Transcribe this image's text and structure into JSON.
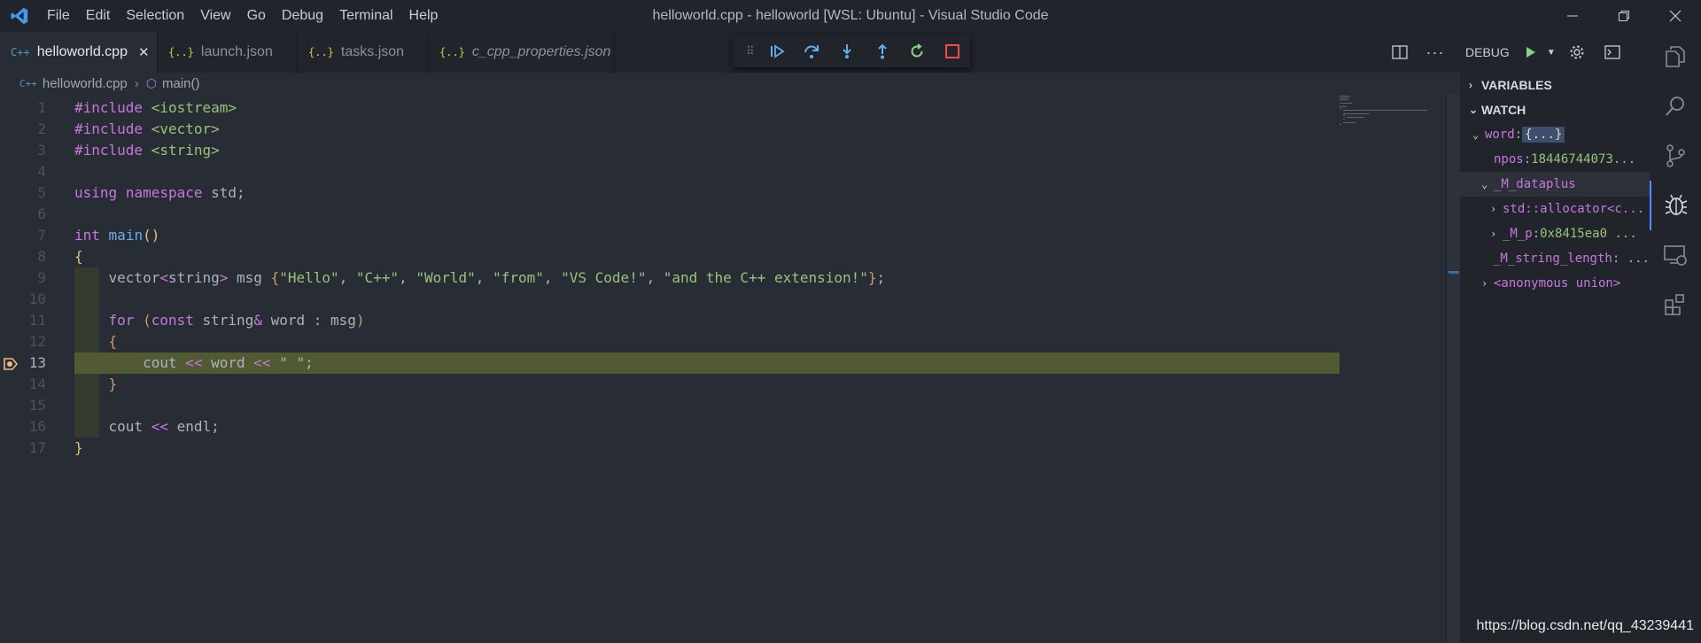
{
  "window": {
    "title": "helloworld.cpp - helloworld [WSL: Ubuntu] - Visual Studio Code",
    "menu": [
      "File",
      "Edit",
      "Selection",
      "View",
      "Go",
      "Debug",
      "Terminal",
      "Help"
    ]
  },
  "tabs": [
    {
      "label": "helloworld.cpp",
      "icon": "C++",
      "active": true,
      "italic": false
    },
    {
      "label": "launch.json",
      "icon": "{..}",
      "active": false,
      "italic": false
    },
    {
      "label": "tasks.json",
      "icon": "{..}",
      "active": false,
      "italic": false
    },
    {
      "label": "c_cpp_properties.json",
      "icon": "{..}",
      "active": false,
      "italic": true
    }
  ],
  "debug_toolbar": {
    "buttons": [
      "continue",
      "step-over",
      "step-into",
      "step-out",
      "restart",
      "stop"
    ]
  },
  "editor_actions": {
    "debug_label": "DEBUG"
  },
  "breadcrumb": {
    "file_icon": "C++",
    "file": "helloworld.cpp",
    "symbol": "main()"
  },
  "editor": {
    "current_line": 13,
    "lines": [
      {
        "n": "1",
        "tokens": [
          [
            "k",
            "#include"
          ],
          [
            "",
            " "
          ],
          [
            "s",
            "<iostream>"
          ]
        ]
      },
      {
        "n": "2",
        "tokens": [
          [
            "k",
            "#include"
          ],
          [
            "",
            " "
          ],
          [
            "s",
            "<vector>"
          ]
        ]
      },
      {
        "n": "3",
        "tokens": [
          [
            "k",
            "#include"
          ],
          [
            "",
            " "
          ],
          [
            "s",
            "<string>"
          ]
        ]
      },
      {
        "n": "4",
        "tokens": []
      },
      {
        "n": "5",
        "tokens": [
          [
            "k",
            "using"
          ],
          [
            "",
            " "
          ],
          [
            "k",
            "namespace"
          ],
          [
            "",
            " std;"
          ]
        ]
      },
      {
        "n": "6",
        "tokens": []
      },
      {
        "n": "7",
        "tokens": [
          [
            "k",
            "int"
          ],
          [
            "",
            " "
          ],
          [
            "f",
            "main"
          ],
          [
            "t",
            "()"
          ]
        ]
      },
      {
        "n": "8",
        "tokens": [
          [
            "t",
            "{"
          ]
        ]
      },
      {
        "n": "9",
        "tokens": [
          [
            "",
            "    vector"
          ],
          [
            "op",
            "<"
          ],
          [
            "",
            "string"
          ],
          [
            "op",
            ">"
          ],
          [
            "",
            " msg "
          ],
          [
            "p",
            "{"
          ],
          [
            "s",
            "\"Hello\""
          ],
          [
            "",
            ", "
          ],
          [
            "s",
            "\"C++\""
          ],
          [
            "",
            ", "
          ],
          [
            "s",
            "\"World\""
          ],
          [
            "",
            ", "
          ],
          [
            "s",
            "\"from\""
          ],
          [
            "",
            ", "
          ],
          [
            "s",
            "\"VS Code!\""
          ],
          [
            "",
            ", "
          ],
          [
            "s",
            "\"and the C++ extension!\""
          ],
          [
            "p",
            "}"
          ],
          [
            "",
            ";"
          ]
        ]
      },
      {
        "n": "10",
        "tokens": []
      },
      {
        "n": "11",
        "tokens": [
          [
            "",
            "    "
          ],
          [
            "k",
            "for"
          ],
          [
            "",
            " "
          ],
          [
            "p",
            "("
          ],
          [
            "k",
            "const"
          ],
          [
            "",
            " string"
          ],
          [
            "op",
            "&"
          ],
          [
            "",
            " word : msg"
          ],
          [
            "p",
            ")"
          ]
        ]
      },
      {
        "n": "12",
        "tokens": [
          [
            "",
            "    "
          ],
          [
            "p",
            "{"
          ]
        ]
      },
      {
        "n": "13",
        "tokens": [
          [
            "",
            "        cout "
          ],
          [
            "op",
            "<<"
          ],
          [
            "",
            " word "
          ],
          [
            "op",
            "<<"
          ],
          [
            "",
            " "
          ],
          [
            "s",
            "\" \""
          ],
          [
            "",
            ";"
          ]
        ]
      },
      {
        "n": "14",
        "tokens": [
          [
            "",
            "    "
          ],
          [
            "p",
            "}"
          ]
        ]
      },
      {
        "n": "15",
        "tokens": []
      },
      {
        "n": "16",
        "tokens": [
          [
            "",
            "    cout "
          ],
          [
            "op",
            "<<"
          ],
          [
            "",
            " endl;"
          ]
        ]
      },
      {
        "n": "17",
        "tokens": [
          [
            "t",
            "}"
          ]
        ]
      }
    ]
  },
  "debug_panel": {
    "variables_title": "VARIABLES",
    "watch_title": "WATCH",
    "watch": [
      {
        "indent": 0,
        "chevron": "open",
        "name": "word",
        "sep": ": ",
        "value": "{...}",
        "value_boxed": true
      },
      {
        "indent": 1,
        "chevron": "",
        "name": "npos",
        "sep": ": ",
        "value": "18446744073...",
        "value_boxed": false
      },
      {
        "indent": 1,
        "chevron": "open",
        "name": "_M_dataplus",
        "sep": "",
        "value": "",
        "value_boxed": false,
        "selected": true
      },
      {
        "indent": 2,
        "chevron": "closed",
        "name": "std::allocator<c...",
        "sep": "",
        "value": "",
        "value_boxed": false
      },
      {
        "indent": 2,
        "chevron": "closed",
        "name": "_M_p",
        "sep": ": ",
        "value": "0x8415ea0 ...",
        "value_boxed": false
      },
      {
        "indent": 1,
        "chevron": "",
        "name": "_M_string_length",
        "sep": ": ...",
        "value": "",
        "value_boxed": false
      },
      {
        "indent": 1,
        "chevron": "closed",
        "name": "<anonymous union>",
        "sep": "",
        "value": "",
        "value_boxed": false
      }
    ]
  },
  "activity_bar": [
    "explorer-icon",
    "search-icon",
    "source-control-icon",
    "debug-icon",
    "remote-explorer-icon",
    "extensions-icon"
  ],
  "watermark": "https://blog.csdn.net/qq_43239441",
  "colors": {
    "accent_blue": "#61afef",
    "string_green": "#98c379",
    "keyword_purple": "#c678dd",
    "current_line": "#525a33",
    "breakpoint_yellow": "#e5c07b"
  }
}
